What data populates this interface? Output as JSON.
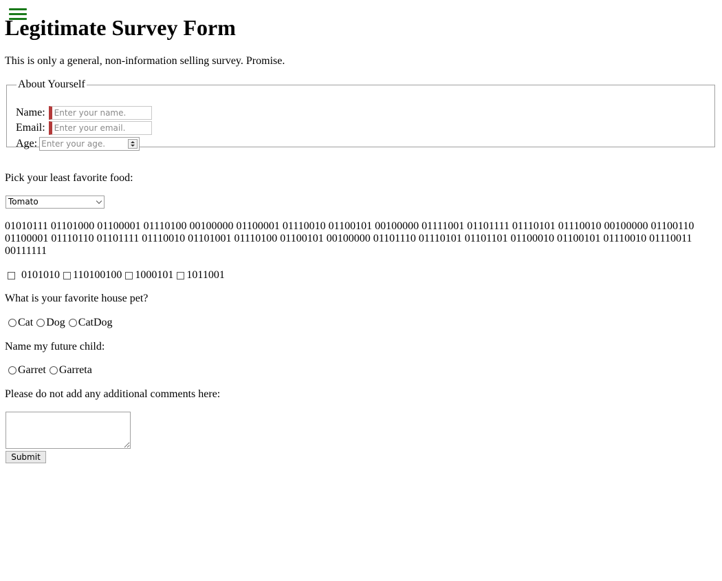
{
  "page": {
    "title": "Legitimate Survey Form",
    "intro": "This is only a general, non-information selling survey. Promise.",
    "menu_icon": "hamburger-menu-icon",
    "menu_icon_color": "#1a7a1a"
  },
  "about": {
    "legend": "About Yourself",
    "name_label": "Name:",
    "name_placeholder": "Enter your name.",
    "email_label": "Email:",
    "email_placeholder": "Enter your email.",
    "age_label": "Age:",
    "age_placeholder": "Enter your age.",
    "required_marker_color": "#b33a3a"
  },
  "food": {
    "question": "Pick your least favorite food:",
    "selected": "Tomato"
  },
  "binary": {
    "text": "01010111 01101000 01100001 01110100 00100000 01100001 01110010 01100101 00100000 01111001 01101111 01110101 01110010 00100000 01100110 01100001 01110110 01101111 01110010 01101001 01110100 01100101 00100000 01101110 01110101 01101101 01100010 01100101 01110010 01110011 00111111",
    "options": [
      "0101010",
      "110100100",
      "1000101",
      "1011001"
    ]
  },
  "pet": {
    "question": "What is your favorite house pet?",
    "options": [
      "Cat",
      "Dog",
      "CatDog"
    ]
  },
  "child": {
    "question": "Name my future child:",
    "options": [
      "Garret",
      "Garreta"
    ]
  },
  "comments": {
    "label": "Please do not add any additional comments here:",
    "value": ""
  },
  "submit_label": "Submit"
}
